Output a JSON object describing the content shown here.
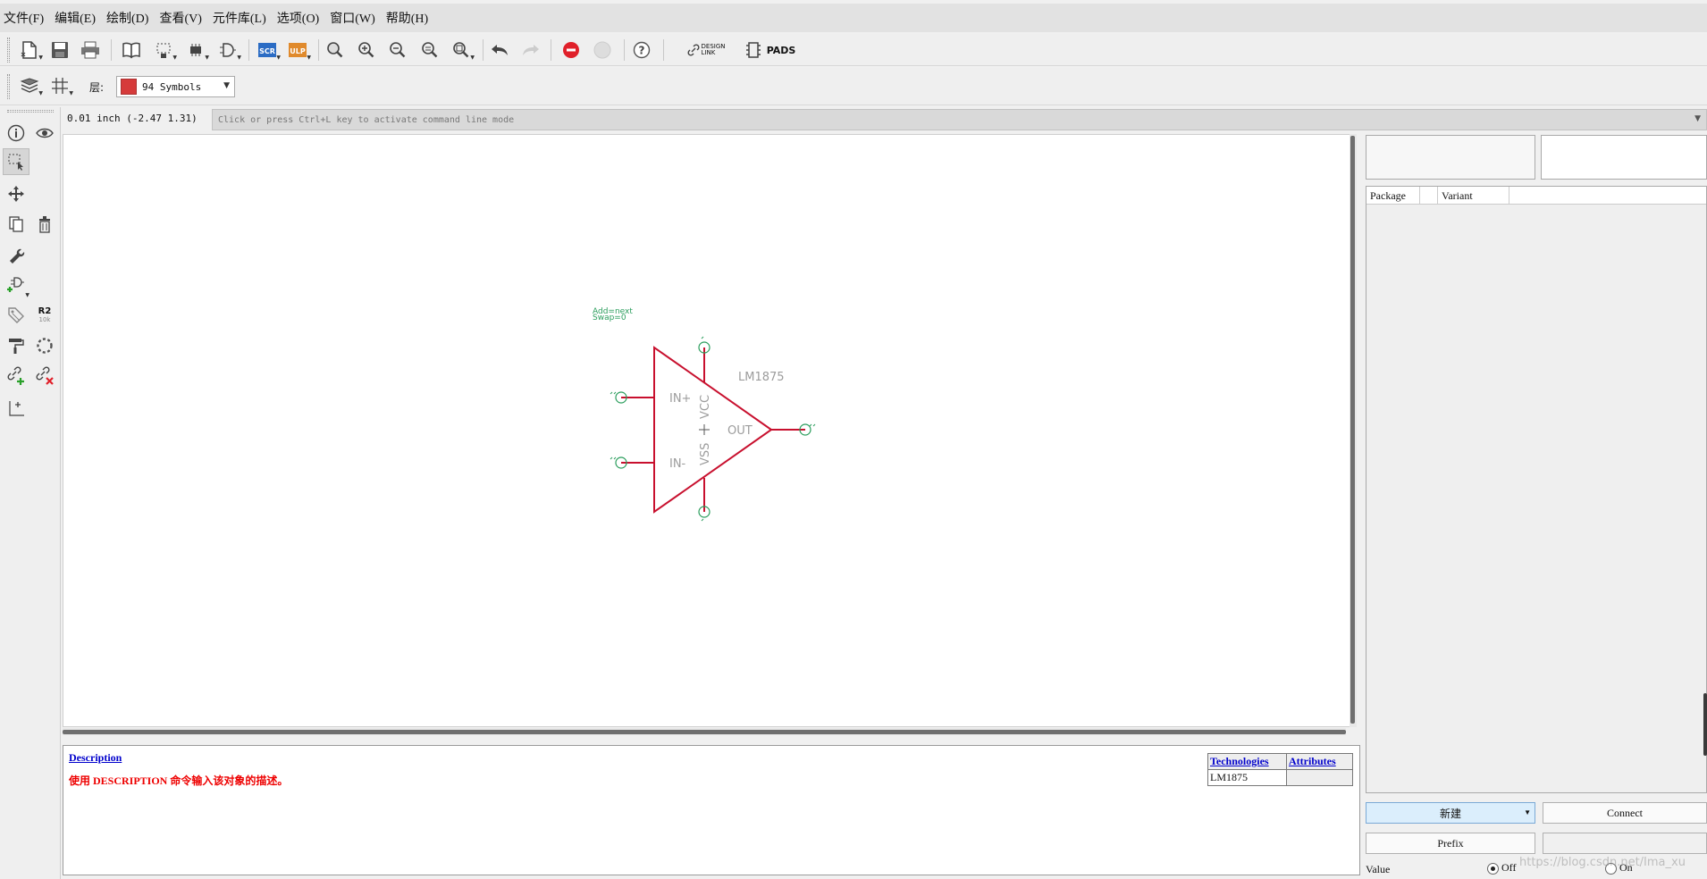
{
  "menu": [
    "文件(F)",
    "编辑(E)",
    "绘制(D)",
    "查看(V)",
    "元件库(L)",
    "选项(O)",
    "窗口(W)",
    "帮助(H)"
  ],
  "toolbar1": {
    "scr_label": "SCR",
    "ulp_label": "ULP",
    "design_link_label_line1": "DESIGN",
    "design_link_label_line2": "LINK",
    "pads_label": "PADS",
    "help_label": "?"
  },
  "toolbar2": {
    "layer_label": "层:",
    "layer_value": "94 Symbols",
    "layer_color": "#d63b3b"
  },
  "lefttools": {
    "r2_label": "R2",
    "r2_sub": "10k"
  },
  "status": {
    "coords": "0.01 inch (-2.47 1.31)",
    "command_placeholder": "Click or press Ctrl+L key to activate command line mode"
  },
  "symbol": {
    "addlevel": "Add=next",
    "swaplevel": "Swap=0",
    "name": "LM1875",
    "pin_in_plus": "IN+",
    "pin_in_minus": "IN-",
    "pin_out": "OUT",
    "pin_vcc": "VCC",
    "pin_vss": "VSS",
    "pin_color": "#c8102e",
    "origin_color": "#2a9d5c"
  },
  "description": {
    "link": "Description",
    "text": "使用 DESCRIPTION 命令输入该对象的描述。"
  },
  "tech_table": {
    "headers": [
      "Technologies",
      "Attributes"
    ],
    "rows": [
      [
        "LM1875",
        ""
      ]
    ]
  },
  "package_table": {
    "headers": [
      "Package",
      "Variant"
    ]
  },
  "buttons": {
    "new": "新建",
    "connect": "Connect",
    "prefix": "Prefix"
  },
  "value_row": {
    "label": "Value",
    "off": "Off",
    "on": "On"
  },
  "watermark": "https://blog.csdn.net/Ima_xu"
}
